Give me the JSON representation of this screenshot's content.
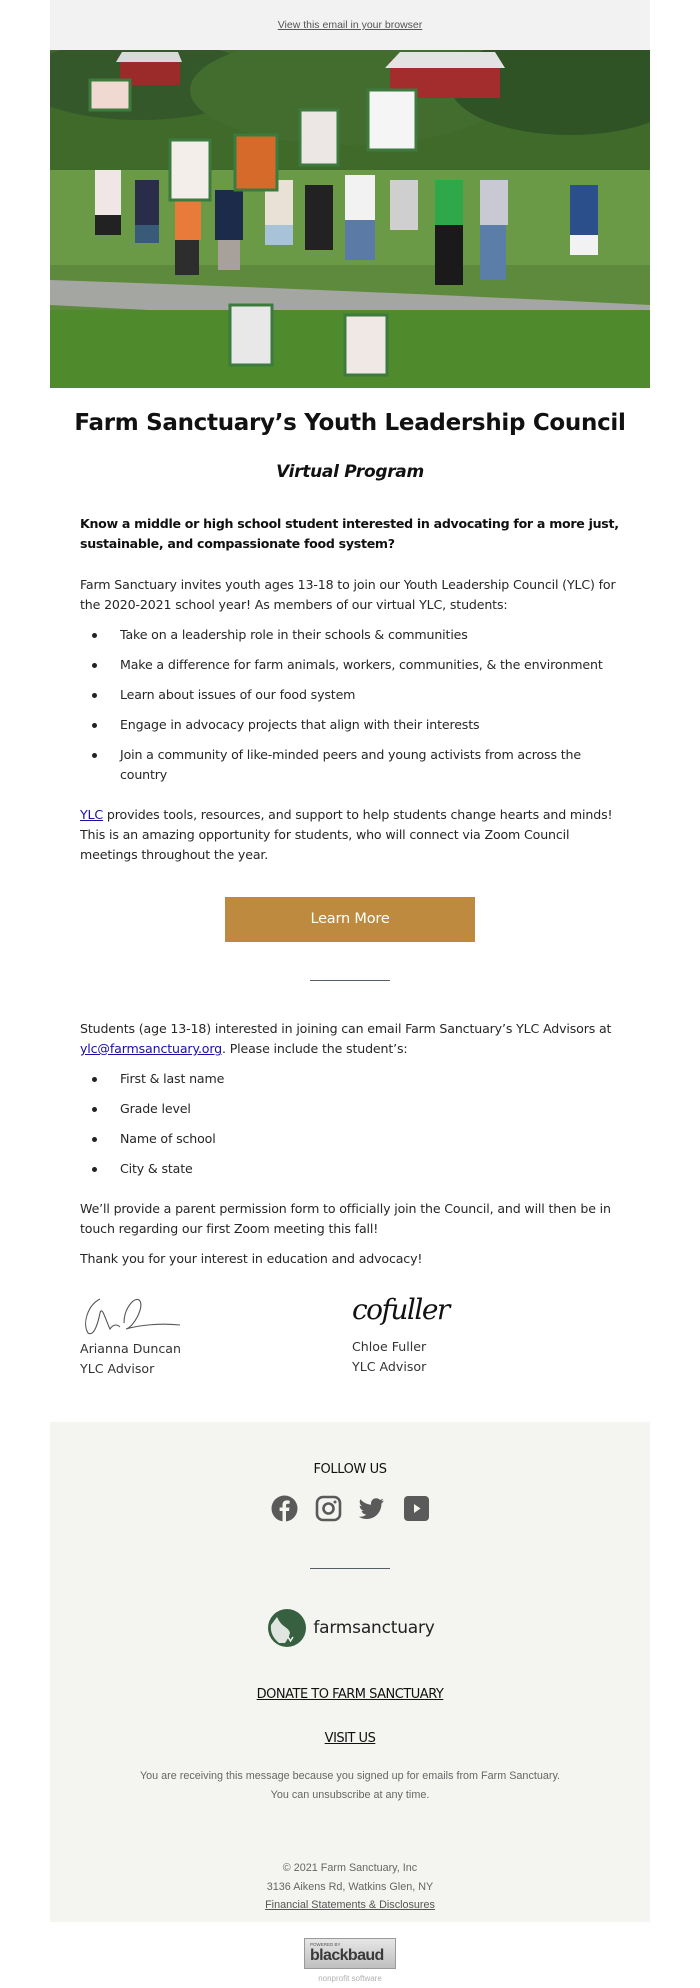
{
  "preheader": {
    "view_in_browser": "View this email in your browser"
  },
  "hero": {
    "alt": "Group of youth jumping and holding Farm Sanctuary signs on a farm field"
  },
  "header": {
    "title": "Farm Sanctuary’s Youth Leadership Council",
    "subtitle": "Virtual Program"
  },
  "intro": {
    "question": "Know a middle or high school student interested in advocating for a more just, sustainable, and compassionate food system?",
    "invite": "Farm Sanctuary invites youth ages 13-18 to join our Youth Leadership Council (YLC) for the 2020-2021 school year! As members of our virtual YLC, students:",
    "benefits": [
      "Take on a leadership role in their schools & communities",
      "Make a difference for farm animals, workers, communities, & the environment",
      "Learn about issues of our food system",
      "Engage in advocacy projects that align with their interests",
      "Join a community of like-minded peers and young activists from across the country"
    ],
    "ylc_link": "YLC",
    "ylc_text": " provides tools, resources, and support to help students change hearts and minds! This is an amazing opportunity for students, who will connect via Zoom Council meetings throughout the year."
  },
  "cta": {
    "learn_more": "Learn More",
    "color": "#bd8a40"
  },
  "apply": {
    "text_before": "Students (age 13-18) interested in joining can email Farm Sanctuary’s YLC Advisors at ",
    "email": "ylc@farmsanctuary.org",
    "text_after": ". Please include the student’s:",
    "requirements": [
      "First & last name",
      "Grade level",
      "Name of school",
      "City & state"
    ],
    "permission": "We’ll provide a parent permission form to officially join the Council, and will then be in touch regarding our first Zoom meeting this fall!",
    "thanks": "Thank you for your interest in education and advocacy!"
  },
  "signatures": [
    {
      "name": "Arianna Duncan",
      "role": "YLC Advisor"
    },
    {
      "name": "Chloe Fuller",
      "role": "YLC Advisor",
      "script": "cofuller"
    }
  ],
  "footer": {
    "follow_us": "FOLLOW US",
    "social": [
      "facebook",
      "instagram",
      "twitter",
      "youtube"
    ],
    "logo_text": "farmsanctuary",
    "logo_color": "#36603f",
    "donate": "DONATE TO FARM SANCTUARY",
    "visit": "VISIT US",
    "notice_line1": "You are receiving this message because you signed up for emails from Farm Sanctuary.",
    "notice_line2": "You can unsubscribe at any time.",
    "copyright": "© 2021 Farm Sanctuary, Inc",
    "address": "3136 Aikens Rd, Watkins Glen, NY",
    "financials": "Financial Statements & Disclosures"
  },
  "badge": {
    "powered_by": "POWERED BY",
    "brand": "blackbaud",
    "tagline": "nonprofit software"
  }
}
